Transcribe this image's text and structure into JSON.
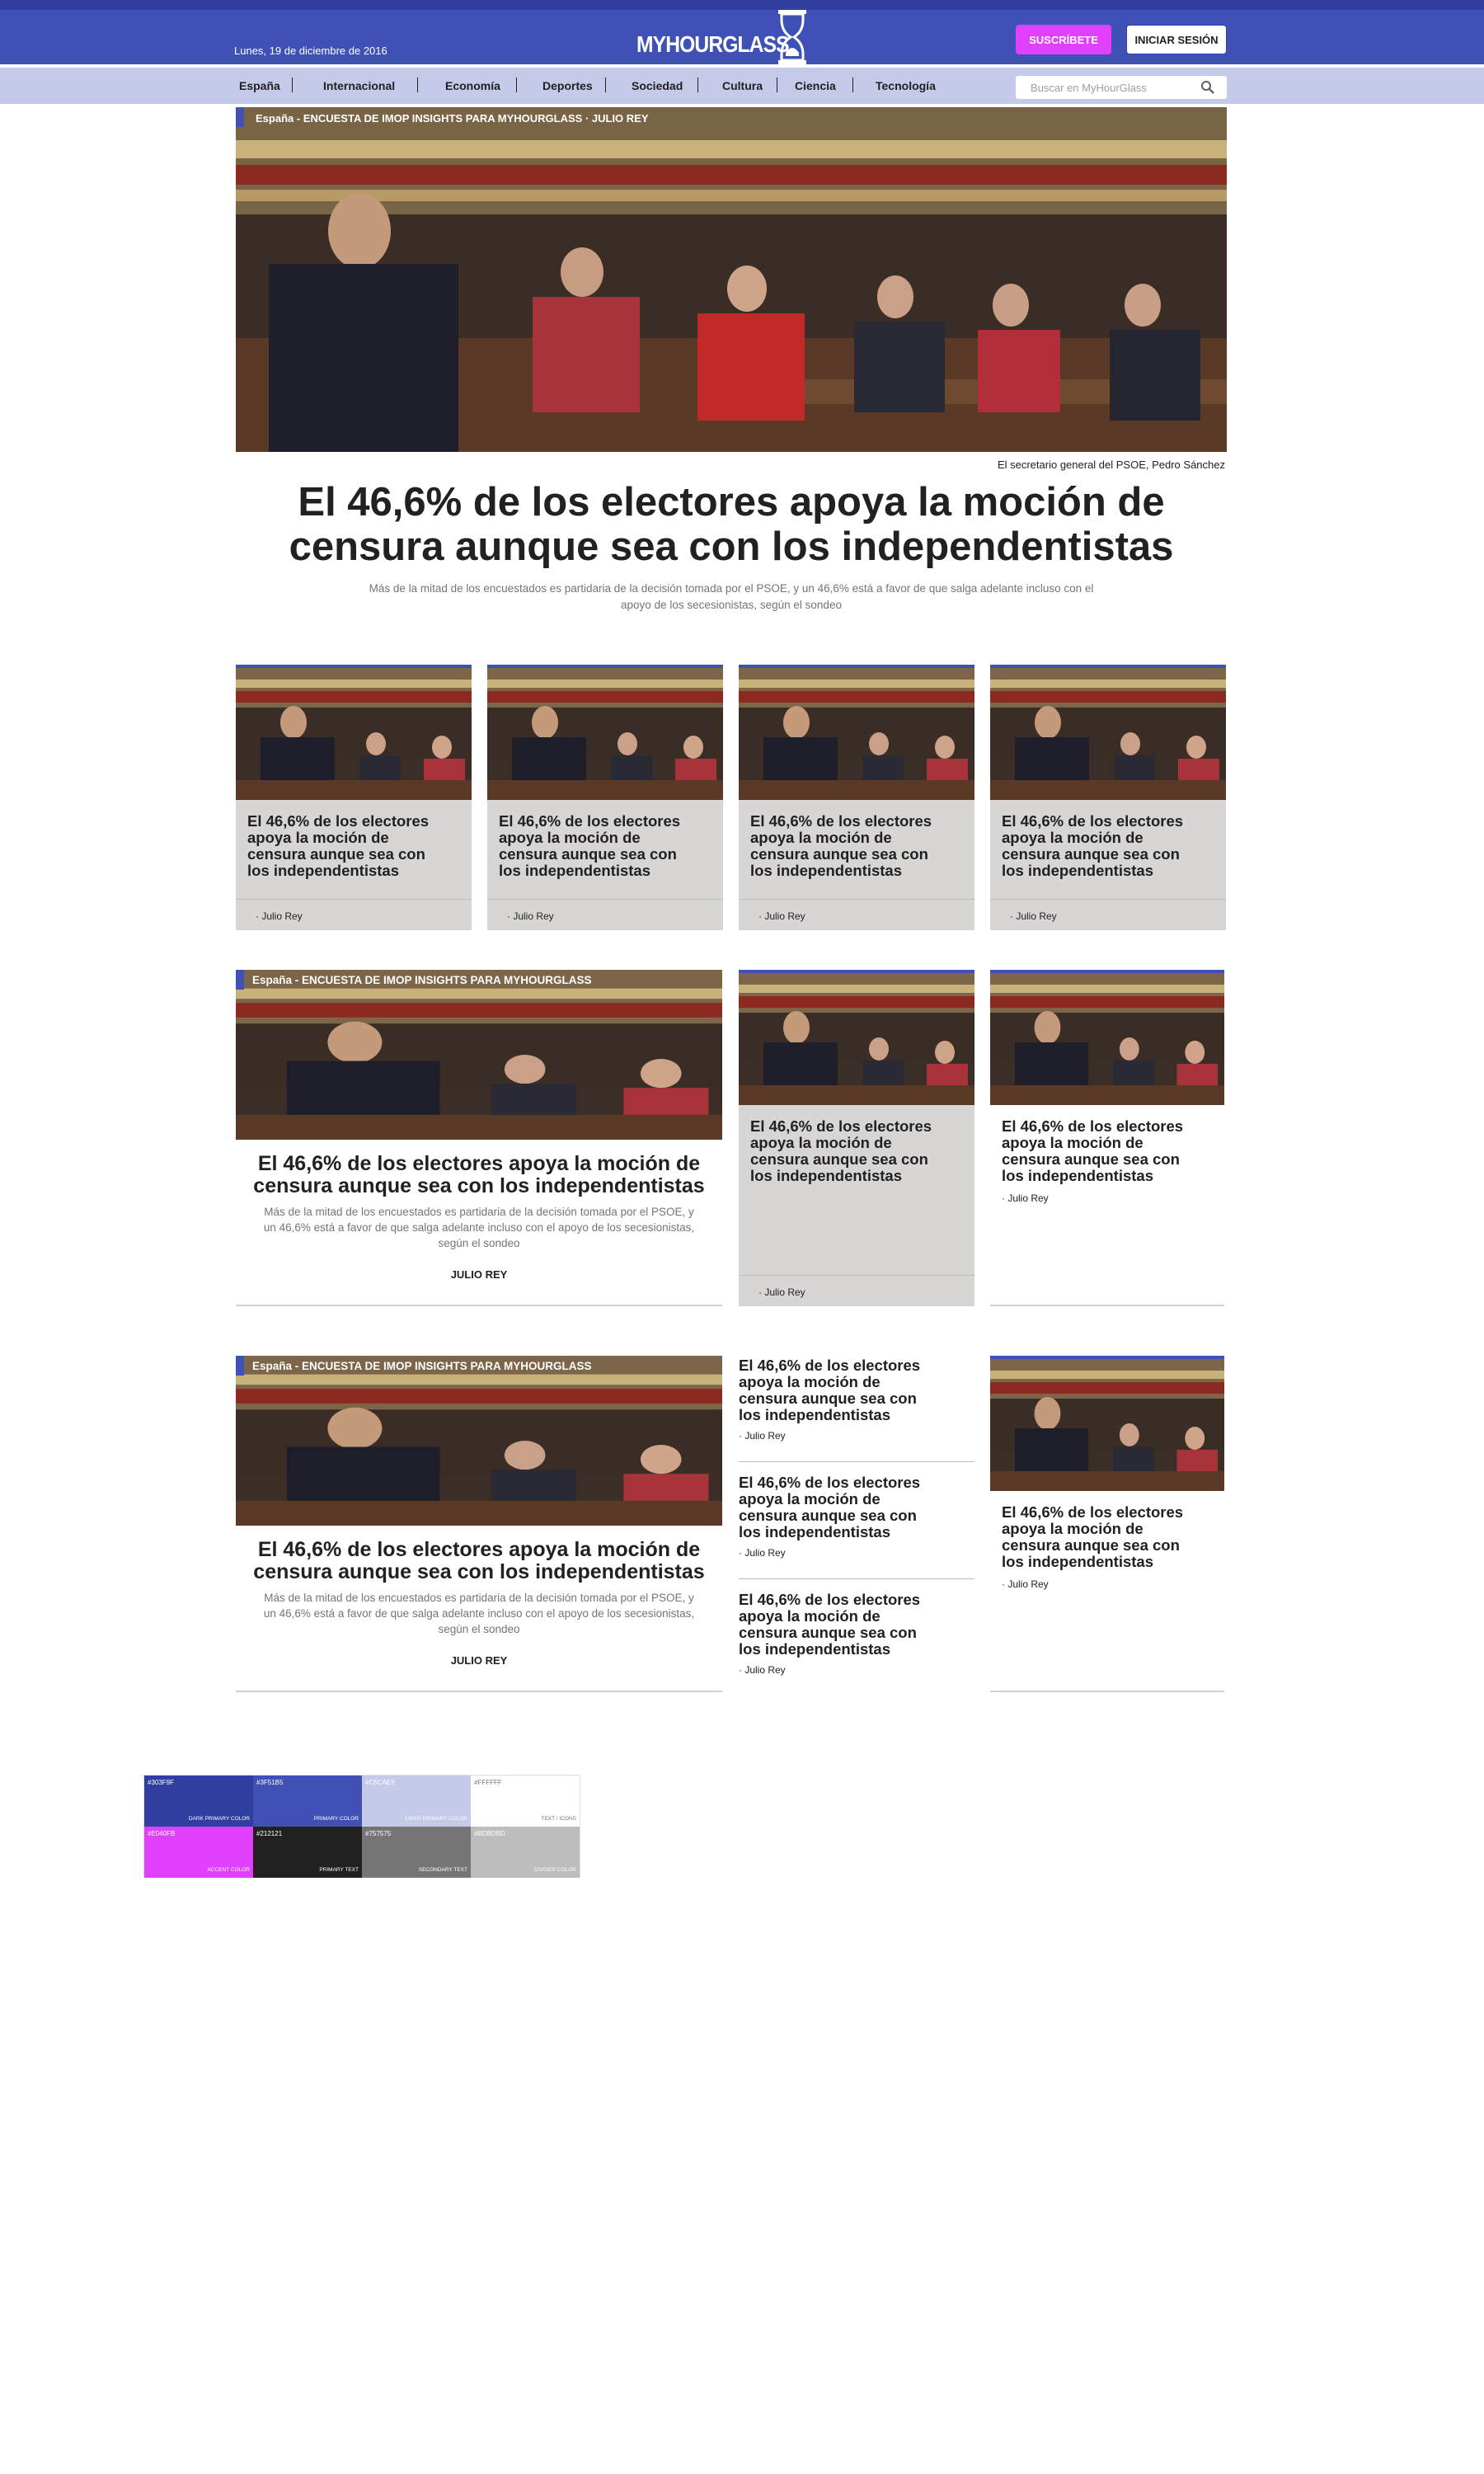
{
  "header": {
    "date": "Lunes, 19 de diciembre de 2016",
    "logo": "MYHOURGLASS",
    "subscribe_label": "SUSCRÍBETE",
    "login_label": "INICIAR SESIÓN"
  },
  "nav": {
    "items": [
      "España",
      "Internacional",
      "Economía",
      "Deportes",
      "Sociedad",
      "Cultura",
      "Ciencia",
      "Tecnología"
    ],
    "search_placeholder": "Buscar en MyHourGlass"
  },
  "hero": {
    "kicker": "España - ENCUESTA DE IMOP INSIGHTS PARA MYHOURGLASS",
    "kicker_author": "· JULIO REY",
    "caption": "El secretario general del PSOE, Pedro Sánchez",
    "title": "El 46,6% de los electores apoya la moción de censura aunque sea con los independentistas",
    "subtitle": "Más de la mitad de los encuestados es partidaria de la decisión tomada por el PSOE, y un 46,6% está a favor de que salga adelante incluso con el apoyo de los secesionistas, según el sondeo"
  },
  "grid_cards": [
    {
      "title": "El 46,6% de los electores apoya la moción de censura aunque sea con los independentistas",
      "author": "· Julio Rey"
    },
    {
      "title": "El 46,6% de los electores apoya la moción de censura aunque sea con los independentistas",
      "author": "· Julio Rey"
    },
    {
      "title": "El 46,6% de los electores apoya la moción de censura aunque sea con los independentistas",
      "author": "· Julio Rey"
    },
    {
      "title": "El 46,6% de los electores apoya la moción de censura aunque sea con los independentistas",
      "author": "· Julio Rey"
    }
  ],
  "section2": {
    "feature": {
      "kicker": "España - ENCUESTA DE IMOP INSIGHTS PARA MYHOURGLASS",
      "title": "El 46,6% de los electores apoya la moción de censura aunque sea con los independentistas",
      "subtitle": "Más de la mitad de los encuestados es partidaria de la decisión tomada por el PSOE, y un 46,6% está a favor de que salga adelante incluso con el apoyo de los secesionistas, según el sondeo",
      "author": "JULIO REY"
    },
    "card": {
      "title": "El 46,6% de los electores apoya la moción de censura aunque sea con los independentistas",
      "author": "· Julio Rey"
    },
    "plain": {
      "title": "El 46,6% de los electores apoya la moción de censura aunque sea con los independentistas",
      "author": "· Julio Rey"
    }
  },
  "section3": {
    "feature": {
      "kicker": "España - ENCUESTA DE IMOP INSIGHTS PARA MYHOURGLASS",
      "title": "El 46,6% de los electores apoya la moción de censura aunque sea con los independentistas",
      "subtitle": "Más de la mitad de los encuestados es partidaria de la decisión tomada por el PSOE, y un 46,6% está a favor de que salga adelante incluso con el apoyo de los secesionistas, según el sondeo",
      "author": "JULIO REY"
    },
    "list": [
      {
        "title": "El 46,6% de los electores apoya la moción de censura aunque sea con los independentistas",
        "author": "· Julio Rey"
      },
      {
        "title": "El 46,6% de los electores apoya la moción de censura aunque sea con los independentistas",
        "author": "· Julio Rey"
      },
      {
        "title": "El 46,6% de los electores apoya la moción de censura aunque sea con los independentistas",
        "author": "· Julio Rey"
      }
    ],
    "plain": {
      "title": "El 46,6% de los electores apoya la moción de censura aunque sea con los independentistas",
      "author": "· Julio Rey"
    }
  },
  "palette": [
    {
      "hex": "#303F9F",
      "label": "DARK PRIMARY COLOR",
      "color": "#303f9f",
      "text": "#ffffff"
    },
    {
      "hex": "#3F51B5",
      "label": "PRIMARY COLOR",
      "color": "#3f51b5",
      "text": "#ffffff"
    },
    {
      "hex": "#C5CAE9",
      "label": "LIGHT PRIMARY COLOR",
      "color": "#c5cae9",
      "text": "#ffffff"
    },
    {
      "hex": "#FFFFFF",
      "label": "TEXT / ICONS",
      "color": "#ffffff",
      "text": "#757575"
    },
    {
      "hex": "#E040FB",
      "label": "ACCENT COLOR",
      "color": "#e040fb",
      "text": "#ffffff"
    },
    {
      "hex": "#212121",
      "label": "PRIMARY TEXT",
      "color": "#212121",
      "text": "#ffffff"
    },
    {
      "hex": "#757575",
      "label": "SECONDARY TEXT",
      "color": "#757575",
      "text": "#ffffff"
    },
    {
      "hex": "#BDBDBD",
      "label": "DIVIDER COLOR",
      "color": "#bdbdbd",
      "text": "#ffffff"
    }
  ],
  "colors": {
    "dark_primary": "#303f9f",
    "primary": "#3f51b5",
    "light_primary": "#c5cae9",
    "accent": "#e040fb"
  }
}
